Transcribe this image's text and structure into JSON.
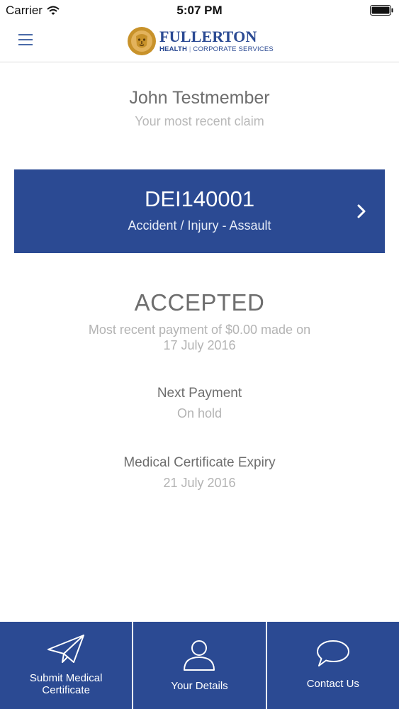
{
  "status_bar": {
    "carrier": "Carrier",
    "time": "5:07 PM",
    "icons": [
      "wifi-icon",
      "battery-icon"
    ]
  },
  "header": {
    "menu_icon": "hamburger-menu-icon",
    "logo_icon": "lion-logo-icon",
    "brand_name": "FULLERTON",
    "brand_sub_left": "HEALTH",
    "brand_sub_sep": "|",
    "brand_sub_right": "CORPORATE SERVICES"
  },
  "member": {
    "name": "John Testmember",
    "subtitle": "Your most recent claim"
  },
  "claim": {
    "id": "DEI140001",
    "type": "Accident / Injury - Assault",
    "chevron_icon": "chevron-right-icon"
  },
  "claim_status": {
    "status": "ACCEPTED",
    "payment_line1": "Most recent payment of $0.00 made on",
    "payment_line2": "17 July 2016"
  },
  "next_payment": {
    "label": "Next Payment",
    "value": "On hold"
  },
  "certificate_expiry": {
    "label": "Medical Certificate Expiry",
    "value": "21 July 2016"
  },
  "tabs": [
    {
      "icon": "paper-plane-icon",
      "label_line1": "Submit Medical",
      "label_line2": "Certificate"
    },
    {
      "icon": "user-icon",
      "label": "Your Details"
    },
    {
      "icon": "speech-bubble-icon",
      "label": "Contact Us"
    }
  ],
  "colors": {
    "brand_blue": "#2b4a93",
    "logo_gold": "#c8922a",
    "text_dark": "#6e6e6e",
    "text_light": "#b3b3b3"
  }
}
